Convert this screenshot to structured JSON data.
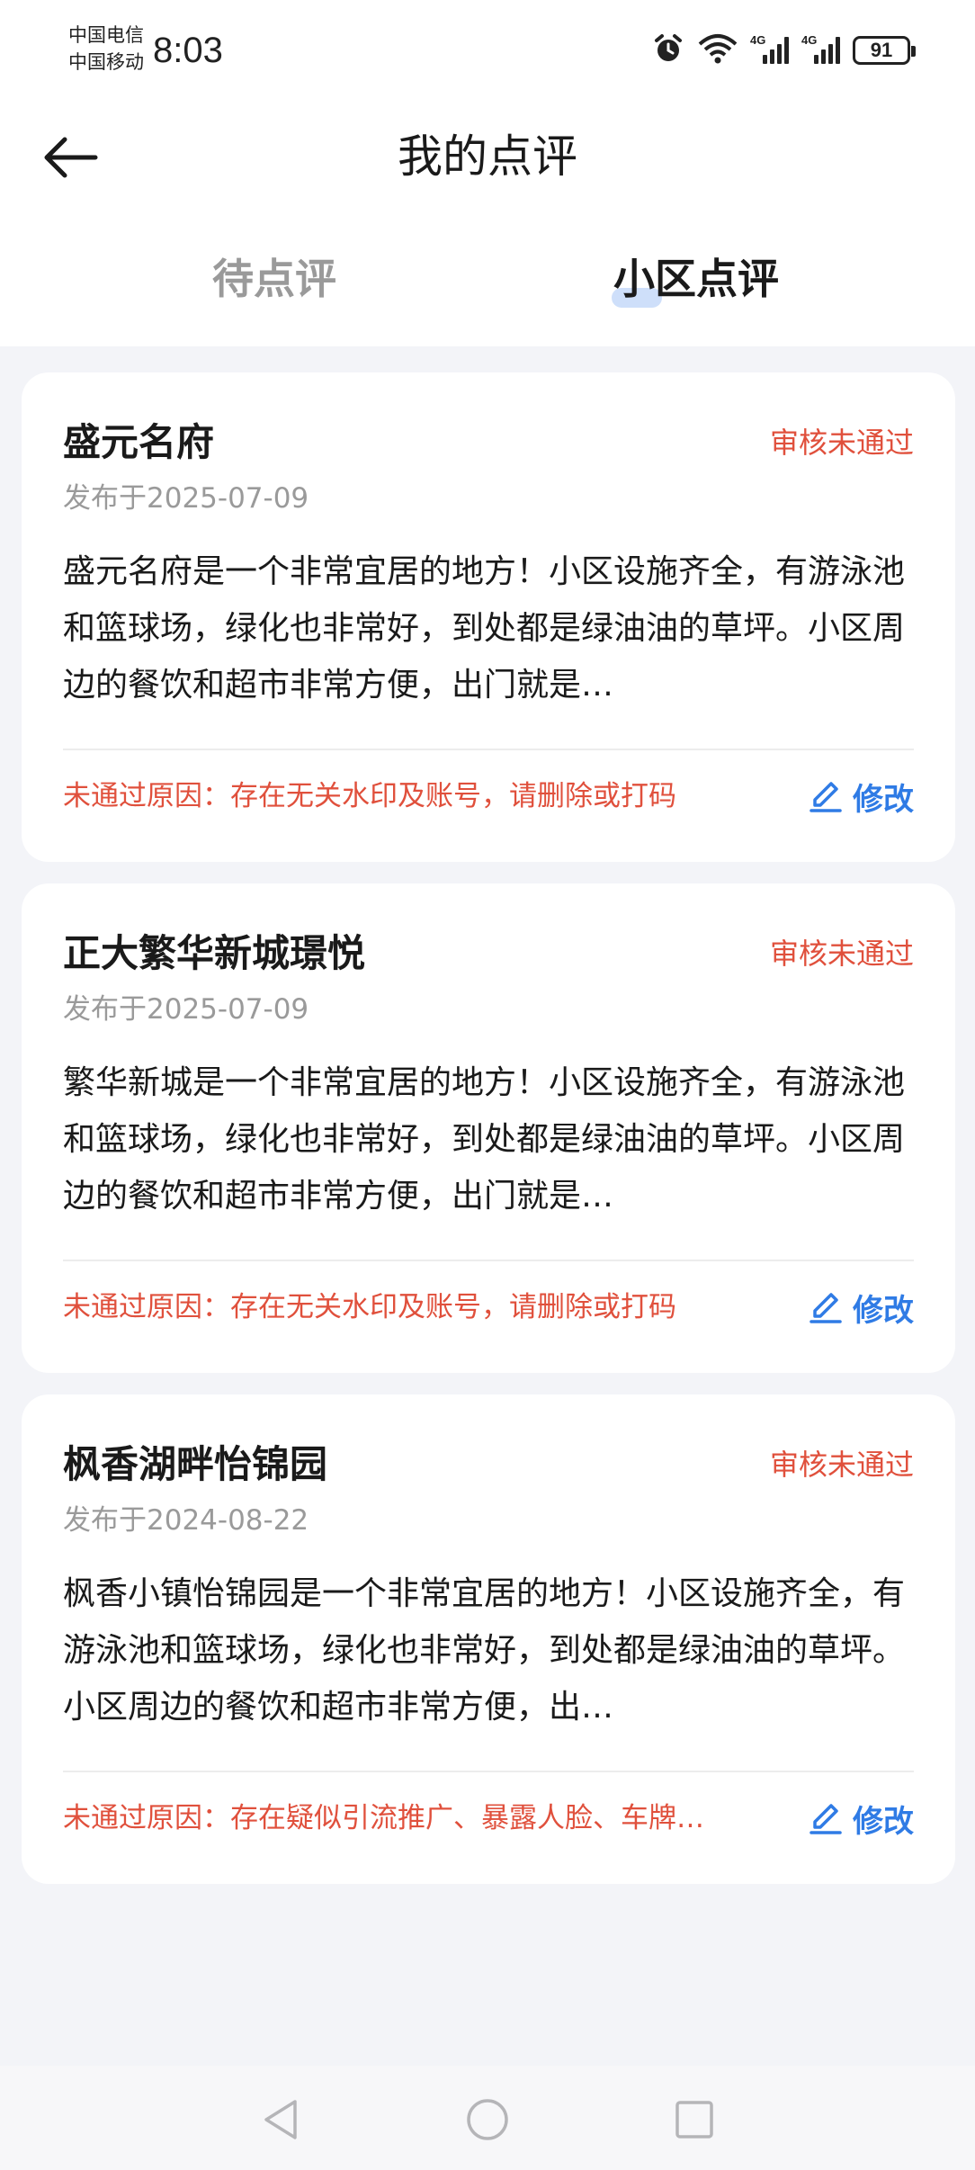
{
  "status_bar": {
    "carrier_1": "中国电信",
    "carrier_2": "中国移动",
    "time": "8:03",
    "net_1": "4G",
    "net_2": "4G",
    "battery": "91"
  },
  "header": {
    "title": "我的点评"
  },
  "tabs": [
    {
      "label": "待点评",
      "active": false
    },
    {
      "label": "小区点评",
      "active": true
    }
  ],
  "reviews": [
    {
      "title": "盛元名府",
      "status": "审核未通过",
      "date": "发布于2025-07-09",
      "content": "盛元名府是一个非常宜居的地方！小区设施齐全，有游泳池和篮球场，绿化也非常好，到处都是绿油油的草坪。小区周边的餐饮和超市非常方便，出门就是…",
      "reason": "未通过原因：存在无关水印及账号，请删除或打码",
      "edit_label": "修改"
    },
    {
      "title": "正大繁华新城璟悦",
      "status": "审核未通过",
      "date": "发布于2025-07-09",
      "content": "繁华新城是一个非常宜居的地方！小区设施齐全，有游泳池和篮球场，绿化也非常好，到处都是绿油油的草坪。小区周边的餐饮和超市非常方便，出门就是…",
      "reason": "未通过原因：存在无关水印及账号，请删除或打码",
      "edit_label": "修改"
    },
    {
      "title": "枫香湖畔怡锦园",
      "status": "审核未通过",
      "date": "发布于2024-08-22",
      "content": "枫香小镇怡锦园是一个非常宜居的地方！小区设施齐全，有游泳池和篮球场，绿化也非常好，到处都是绿油油的草坪。小区周边的餐饮和超市非常方便，出…",
      "reason": "未通过原因：存在疑似引流推广、暴露人脸、车牌…",
      "edit_label": "修改"
    }
  ],
  "colors": {
    "accent": "#2f7be5",
    "error": "#e0503c",
    "muted": "#9a9a9a",
    "background": "#f3f4f8"
  },
  "icons": {
    "back": "arrow-left-icon",
    "edit": "pencil-icon",
    "alarm": "alarm-icon",
    "wifi": "wifi-icon"
  }
}
